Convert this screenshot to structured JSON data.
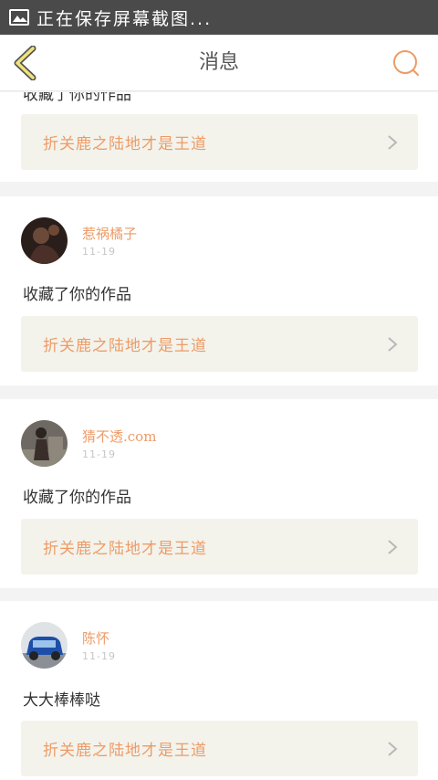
{
  "status_bar": {
    "icon": "image-icon",
    "text": "正在保存屏幕截图..."
  },
  "nav": {
    "title": "消息",
    "back_icon": "back-chevron-icon",
    "search_icon": "search-icon",
    "accent": "#ee9b66"
  },
  "top_fragment": {
    "message": "收藏了你的作品",
    "work_title": "折关鹿之陆地才是王道"
  },
  "items": [
    {
      "username": "惹祸橘子",
      "date": "11-19",
      "message": "收藏了你的作品",
      "work_title": "折关鹿之陆地才是王道"
    },
    {
      "username": "猜不透.com",
      "date": "11-19",
      "message": "收藏了你的作品",
      "work_title": "折关鹿之陆地才是王道"
    },
    {
      "username": "陈怀",
      "date": "11-19",
      "message": "大大棒棒哒",
      "work_title": "折关鹿之陆地才是王道"
    }
  ]
}
